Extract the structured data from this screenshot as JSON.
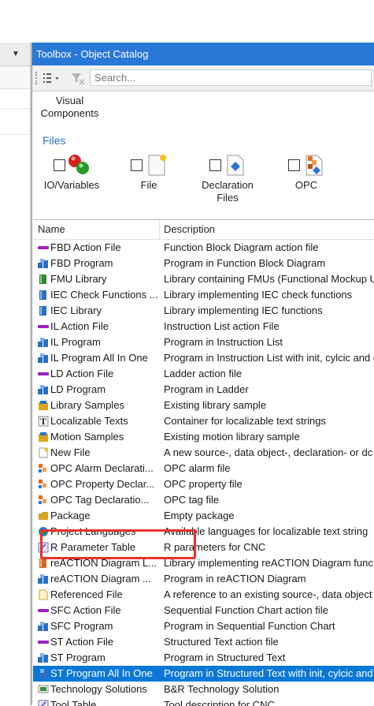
{
  "toolbox": {
    "title": "Toolbox - Object Catalog",
    "search_placeholder": "Search...",
    "visual_components_label": "Visual\nComponents",
    "files_section_label": "Files",
    "categories": [
      {
        "label": "IO/Variables",
        "icon": "io-variables-icon"
      },
      {
        "label": "File",
        "icon": "file-icon"
      },
      {
        "label": "Declaration Files",
        "icon": "declaration-files-icon"
      },
      {
        "label": "OPC",
        "icon": "opc-icon"
      }
    ],
    "columns": [
      "Name",
      "Description"
    ],
    "items": [
      {
        "name": "FBD Action File",
        "description": "Function Block Diagram action file",
        "icon": "action-file-icon",
        "color": "#a020c0"
      },
      {
        "name": "FBD Program",
        "description": "Program in Function Block Diagram",
        "icon": "program-icon",
        "color": "#2a6fc4"
      },
      {
        "name": "FMU Library",
        "description": "Library containing FMUs (Functional Mockup U",
        "icon": "library-icon",
        "color": "#2e8b2e"
      },
      {
        "name": "IEC Check Functions ...",
        "description": "Library implementing IEC check functions",
        "icon": "library-icon",
        "color": "#2a6fc4"
      },
      {
        "name": "IEC Library",
        "description": "Library implementing IEC functions",
        "icon": "library-icon",
        "color": "#2a6fc4"
      },
      {
        "name": "IL Action File",
        "description": "Instruction List action File",
        "icon": "action-file-icon",
        "color": "#a020c0"
      },
      {
        "name": "IL Program",
        "description": "Program in Instruction List",
        "icon": "program-icon",
        "color": "#2a6fc4"
      },
      {
        "name": "IL Program All In One",
        "description": "Program in Instruction List with init, cylcic and e",
        "icon": "program-icon",
        "color": "#2a6fc4"
      },
      {
        "name": "LD Action File",
        "description": "Ladder action file",
        "icon": "action-file-icon",
        "color": "#a020c0"
      },
      {
        "name": "LD Program",
        "description": "Program in Ladder",
        "icon": "program-icon",
        "color": "#2a6fc4"
      },
      {
        "name": "Library Samples",
        "description": "Existing library sample",
        "icon": "samples-icon",
        "color": "#d9a520"
      },
      {
        "name": "Localizable Texts",
        "description": "Container for localizable text strings",
        "icon": "text-icon",
        "color": "#333333"
      },
      {
        "name": "Motion Samples",
        "description": "Existing motion library sample",
        "icon": "samples-icon",
        "color": "#d9a520"
      },
      {
        "name": "New File",
        "description": "A new source-, data object-, declaration- or dc",
        "icon": "new-file-icon",
        "color": "#f0c030"
      },
      {
        "name": "OPC Alarm Declarati...",
        "description": "OPC alarm file",
        "icon": "opc-icon",
        "color": "#e07020"
      },
      {
        "name": "OPC Property Declar...",
        "description": "OPC property file",
        "icon": "opc-icon",
        "color": "#e07020"
      },
      {
        "name": "OPC Tag Declaratio...",
        "description": "OPC tag file",
        "icon": "opc-icon",
        "color": "#e07020"
      },
      {
        "name": "Package",
        "description": "Empty package",
        "icon": "package-icon",
        "color": "#d9a520"
      },
      {
        "name": "Project Languages",
        "description": "Available languages for localizable text string",
        "icon": "globe-icon",
        "color": "#2e8b57"
      },
      {
        "name": "R Parameter Table",
        "description": "R parameters for CNC",
        "icon": "table-icon",
        "color": "#6a6acd"
      },
      {
        "name": "reACTION Diagram L...",
        "description": "Library implementing reACTION Diagram func",
        "icon": "library-icon",
        "color": "#d06a20"
      },
      {
        "name": "reACTION Diagram ...",
        "description": "Program in reACTION Diagram",
        "icon": "program-icon",
        "color": "#2a6fc4"
      },
      {
        "name": "Referenced File",
        "description": "A reference to an existing source-, data object",
        "icon": "referenced-file-icon",
        "color": "#f0c030"
      },
      {
        "name": "SFC Action File",
        "description": "Sequential Function Chart action file",
        "icon": "action-file-icon",
        "color": "#a020c0"
      },
      {
        "name": "SFC Program",
        "description": "Program in Sequential Function Chart",
        "icon": "program-icon",
        "color": "#2a6fc4"
      },
      {
        "name": "ST Action File",
        "description": "Structured Text action file",
        "icon": "action-file-icon",
        "color": "#a020c0"
      },
      {
        "name": "ST Program",
        "description": "Program in Structured Text",
        "icon": "program-icon",
        "color": "#2a6fc4"
      },
      {
        "name": "ST Program All In One",
        "description": "Program in Structured Text with init, cylcic and",
        "icon": "program-icon",
        "color": "#2a6fc4",
        "selected": true
      },
      {
        "name": "Technology Solutions",
        "description": "B&R Technology Solution",
        "icon": "technology-icon",
        "color": "#3a8a3a"
      },
      {
        "name": "Tool Table",
        "description": "Tool description for CNC",
        "icon": "table-icon",
        "color": "#6a6acd"
      }
    ]
  },
  "colors": {
    "title_bar": "#2a78d6",
    "selection": "#0b78d7",
    "highlight_box": "#e8332a",
    "files_label": "#2a6fc4"
  }
}
